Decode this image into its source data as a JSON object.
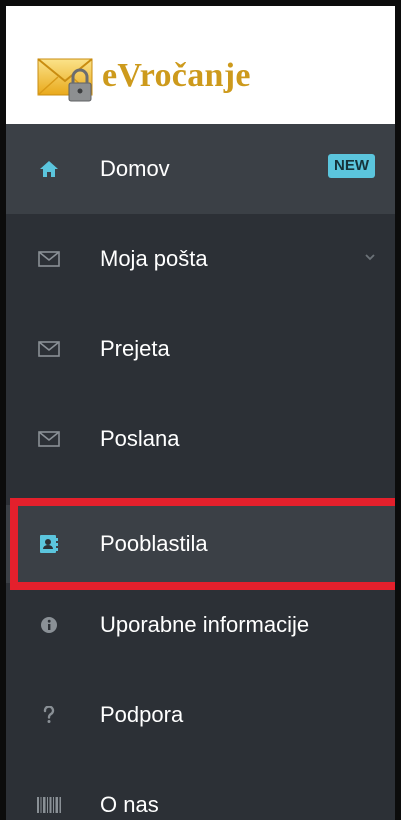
{
  "app": {
    "brand": "eVročanje"
  },
  "sidebar": {
    "items": [
      {
        "id": "domov",
        "label": "Domov",
        "icon": "home-icon",
        "badge": "NEW"
      },
      {
        "id": "moja-posta",
        "label": "Moja pošta",
        "icon": "envelope-icon",
        "expandable": true
      },
      {
        "id": "prejeta",
        "label": "Prejeta",
        "icon": "envelope-icon"
      },
      {
        "id": "poslana",
        "label": "Poslana",
        "icon": "envelope-icon"
      },
      {
        "id": "pooblastila",
        "label": "Pooblastila",
        "icon": "address-book-icon",
        "highlighted": true
      },
      {
        "id": "uporabne-informacije",
        "label": "Uporabne informacije",
        "icon": "info-circle-icon"
      },
      {
        "id": "podpora",
        "label": "Podpora",
        "icon": "question-icon"
      },
      {
        "id": "o-nas",
        "label": "O nas",
        "icon": "barcode-icon"
      }
    ]
  },
  "colors": {
    "sidebar_bg": "#2c3036",
    "item_hover_bg": "#3b4046",
    "accent": "#5bc5dd",
    "brand_gold": "#cd9a1c",
    "highlight_red": "#e4202c"
  }
}
